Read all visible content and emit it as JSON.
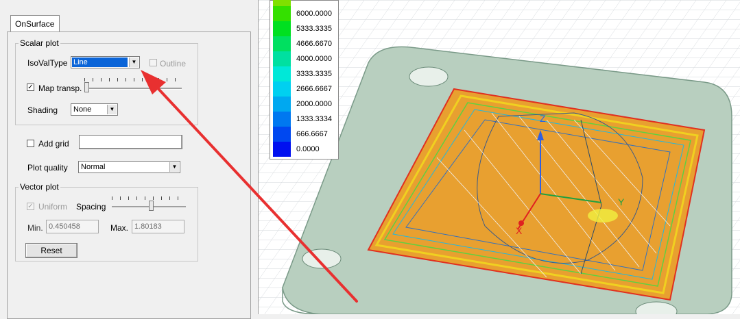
{
  "tab": {
    "label": "OnSurface"
  },
  "scalar_plot": {
    "title": "Scalar plot",
    "isoval_label": "IsoValType",
    "isoval_value": "Line",
    "outline_label": "Outline",
    "map_transp_label": "Map transp.",
    "map_transp_checked": true,
    "map_transp_level": 0.0,
    "shading_label": "Shading",
    "shading_value": "None"
  },
  "add_grid": {
    "label": "Add grid",
    "checked": false
  },
  "plot_quality": {
    "label": "Plot quality",
    "value": "Normal"
  },
  "vector_plot": {
    "title": "Vector plot",
    "uniform_label": "Uniform",
    "uniform_checked": true,
    "spacing_label": "Spacing",
    "spacing_level": 0.5,
    "min_label": "Min.",
    "min_value": "0.450458",
    "max_label": "Max.",
    "max_value": "1.80183",
    "reset_label": "Reset"
  },
  "legend": {
    "values": [
      "6000.0000",
      "5333.3335",
      "4666.6670",
      "4000.0000",
      "3333.3335",
      "2666.6667",
      "2000.0000",
      "1333.3334",
      "666.6667",
      "0.0000"
    ],
    "colors": [
      "#34e000",
      "#00e020",
      "#00e060",
      "#00e0a0",
      "#00e8d8",
      "#00d0f0",
      "#00a8f0",
      "#0078f0",
      "#0048f0",
      "#0010f0"
    ],
    "top_color": "#80e000"
  },
  "axes": {
    "x": "X",
    "y": "Y",
    "z": "Z"
  },
  "colors": {
    "plate": "#b8cfbf",
    "surface": "#e8a030",
    "annotation_arrow": "#e83030"
  }
}
